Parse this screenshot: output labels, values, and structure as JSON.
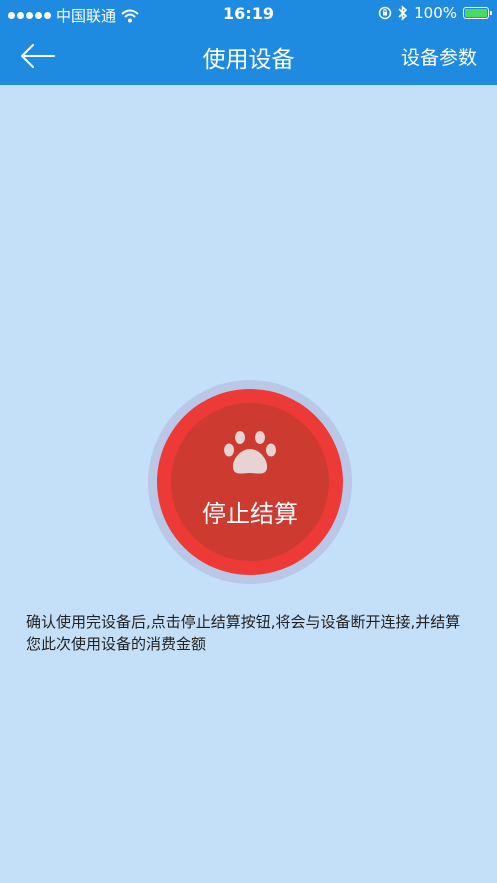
{
  "status_bar": {
    "carrier": "中国联通",
    "time": "16:19",
    "battery": "100%",
    "battery_level": 1.0,
    "icons": [
      "signal-dots",
      "wifi-icon",
      "orientation-lock-icon",
      "bluetooth-icon",
      "battery-icon"
    ]
  },
  "nav": {
    "back_icon": "back-arrow-icon",
    "title": "使用设备",
    "right_label": "设备参数"
  },
  "main": {
    "stop_button_icon": "paw-icon",
    "stop_button_label": "停止结算",
    "notice_text": "确认使用完设备后,点击停止结算按钮,将会与设备断开连接,并结算您此次使用设备的消费金额"
  },
  "colors": {
    "nav_background": "#1e8be0",
    "page_background": "#c4e0f9",
    "stop_button_outer": "#ee3a36",
    "stop_button_inner": "#cd3a30",
    "battery_fill": "#4cd964"
  }
}
